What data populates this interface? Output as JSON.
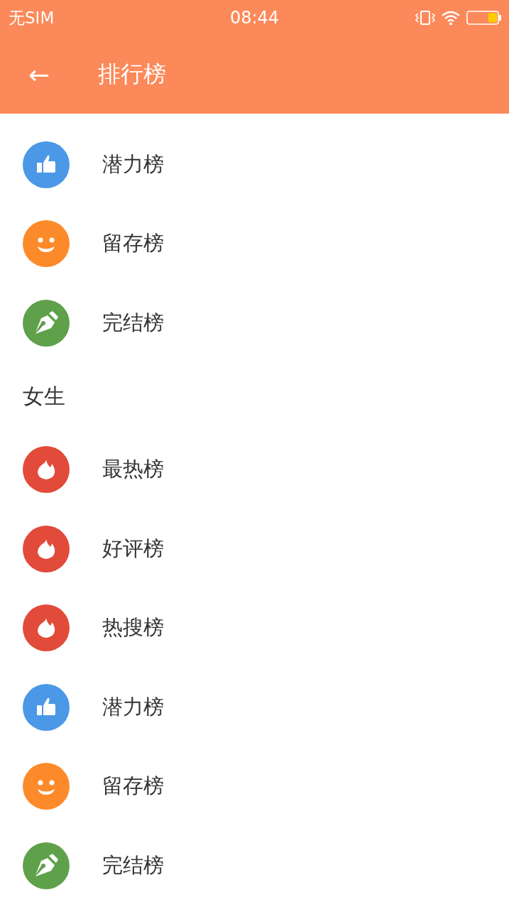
{
  "status_bar": {
    "carrier": "无SIM",
    "time": "08:44"
  },
  "toolbar": {
    "back": "←",
    "title": "排行榜"
  },
  "groups": [
    {
      "items": [
        {
          "label": "潜力榜",
          "kind": "thumb",
          "color": "#4a98e6"
        },
        {
          "label": "留存榜",
          "kind": "smile",
          "color": "#fd8a2a"
        },
        {
          "label": "完结榜",
          "kind": "pen",
          "color": "#5fa04a"
        }
      ]
    },
    {
      "title": "女生",
      "items": [
        {
          "label": "最热榜",
          "kind": "fire",
          "color": "#e24a3a"
        },
        {
          "label": "好评榜",
          "kind": "fire",
          "color": "#e24a3a"
        },
        {
          "label": "热搜榜",
          "kind": "fire",
          "color": "#e24a3a"
        },
        {
          "label": "潜力榜",
          "kind": "thumb",
          "color": "#4a98e6"
        },
        {
          "label": "留存榜",
          "kind": "smile",
          "color": "#fd8a2a"
        },
        {
          "label": "完结榜",
          "kind": "pen",
          "color": "#5fa04a"
        }
      ]
    }
  ]
}
